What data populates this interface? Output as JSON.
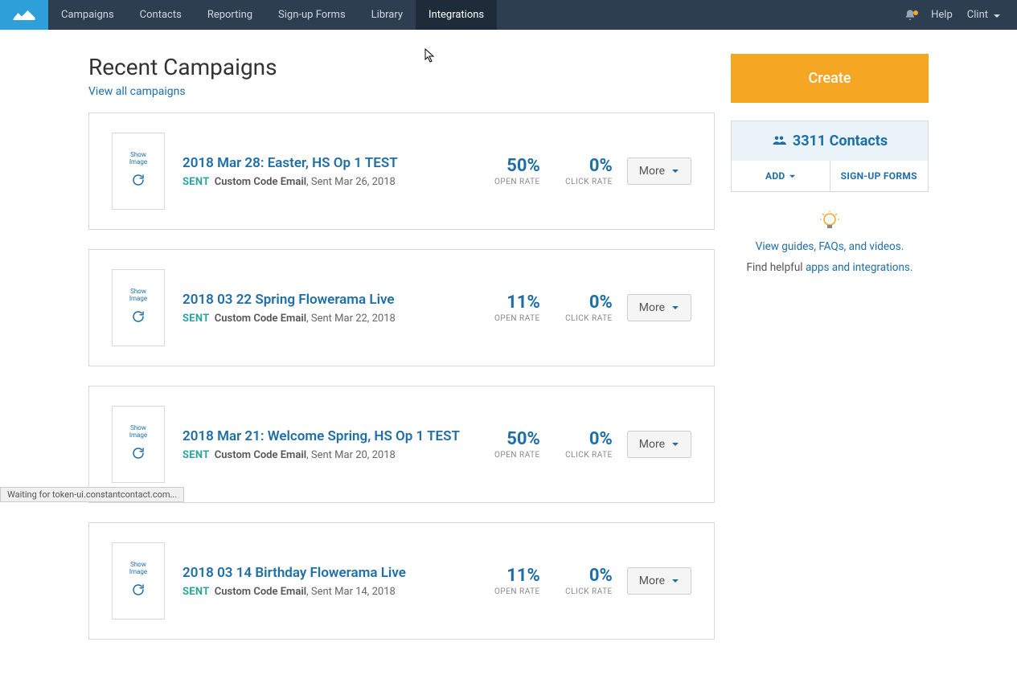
{
  "nav": {
    "items": [
      {
        "label": "Campaigns"
      },
      {
        "label": "Contacts"
      },
      {
        "label": "Reporting"
      },
      {
        "label": "Sign-up Forms"
      },
      {
        "label": "Library"
      },
      {
        "label": "Integrations"
      }
    ],
    "help": "Help",
    "user": "Clint"
  },
  "page": {
    "title": "Recent Campaigns",
    "view_all": "View all campaigns"
  },
  "campaigns": [
    {
      "thumb_text": "Show\nImage",
      "title": "2018 Mar 28: Easter, HS Op 1 TEST",
      "status": "SENT",
      "type": "Custom Code Email",
      "sent": ", Sent Mar 26, 2018",
      "open_rate": "50%",
      "click_rate": "0%"
    },
    {
      "thumb_text": "Show\nImage",
      "title": "2018 03 22 Spring Flowerama Live",
      "status": "SENT",
      "type": "Custom Code Email",
      "sent": ", Sent Mar 22, 2018",
      "open_rate": "11%",
      "click_rate": "0%"
    },
    {
      "thumb_text": "Show\nImage",
      "title": "2018 Mar 21: Welcome Spring, HS Op 1 TEST",
      "status": "SENT",
      "type": "Custom Code Email",
      "sent": ", Sent Mar 20, 2018",
      "open_rate": "50%",
      "click_rate": "0%"
    },
    {
      "thumb_text": "Show\nImage",
      "title": "2018 03 14 Birthday Flowerama Live",
      "status": "SENT",
      "type": "Custom Code Email",
      "sent": ", Sent Mar 14, 2018",
      "open_rate": "11%",
      "click_rate": "0%"
    }
  ],
  "labels": {
    "open_rate": "OPEN RATE",
    "click_rate": "CLICK RATE",
    "more": "More"
  },
  "sidebar": {
    "create": "Create",
    "contacts_count": "3311 Contacts",
    "add": "ADD",
    "signup_forms": "SIGN-UP FORMS",
    "guides_link": "View guides, FAQs, and videos.",
    "find_helpful": "Find helpful ",
    "apps_link": "apps and integrations."
  },
  "statusbar": "Waiting for token-ui.constantcontact.com..."
}
